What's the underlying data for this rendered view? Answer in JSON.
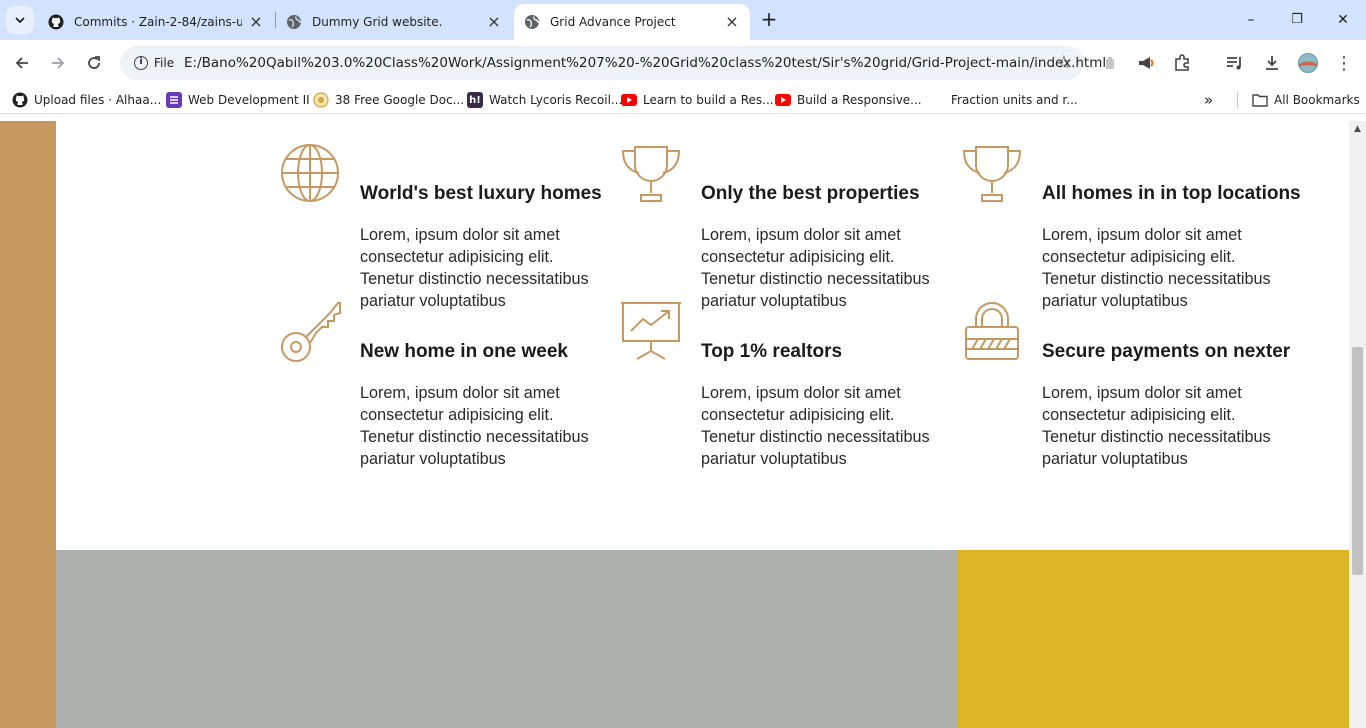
{
  "browser": {
    "tabs": [
      {
        "title": "Commits · Zain-2-84/zains-used",
        "icon": "github-icon",
        "active": false
      },
      {
        "title": "Dummy Grid website.",
        "icon": "globe-icon",
        "active": false
      },
      {
        "title": "Grid Advance Project",
        "icon": "globe-icon",
        "active": true
      }
    ],
    "window_controls": {
      "minimize": "–",
      "restore": "❐",
      "close": "✕"
    },
    "omnibox": {
      "site_label": "File",
      "url": "E:/Bano%20Qabil%203.0%20Class%20Work/Assignment%207%20-%20Grid%20class%20test/Sir's%20grid/Grid-Project-main/index.html"
    },
    "bookmarks": [
      {
        "label": "Upload files · Alhaa...",
        "icon": "github-icon"
      },
      {
        "label": "Web Development II",
        "icon": "list-icon"
      },
      {
        "label": "38 Free Google Doc...",
        "icon": "circle-icon"
      },
      {
        "label": "Watch Lycoris Recoil...",
        "icon": "h-icon"
      },
      {
        "label": "Learn to build a Res...",
        "icon": "youtube-icon"
      },
      {
        "label": "Build a Responsive...",
        "icon": "youtube-icon"
      },
      {
        "label": "Fraction units and r...",
        "icon": "blank-icon"
      }
    ],
    "bookmarks_more": "»",
    "all_bookmarks": "All Bookmarks"
  },
  "page": {
    "accent_color": "#c69963",
    "features": [
      {
        "icon": "globe-icon",
        "title": "World's best luxury homes",
        "text": "Lorem, ipsum dolor sit amet consectetur adipisicing elit. Tenetur distinctio necessitatibus pariatur voluptatibus"
      },
      {
        "icon": "trophy-icon",
        "title": "Only the best properties",
        "text": "Lorem, ipsum dolor sit amet consectetur adipisicing elit. Tenetur distinctio necessitatibus pariatur voluptatibus"
      },
      {
        "icon": "trophy-icon",
        "title": "All homes in in top locations",
        "text": "Lorem, ipsum dolor sit amet consectetur adipisicing elit. Tenetur distinctio necessitatibus pariatur voluptatibus"
      },
      {
        "icon": "key-icon",
        "title": "New home in one week",
        "text": "Lorem, ipsum dolor sit amet consectetur adipisicing elit. Tenetur distinctio necessitatibus pariatur voluptatibus"
      },
      {
        "icon": "presentation-chart-icon",
        "title": "Top 1% realtors",
        "text": "Lorem, ipsum dolor sit amet consectetur adipisicing elit. Tenetur distinctio necessitatibus pariatur voluptatibus"
      },
      {
        "icon": "lock-icon",
        "title": "Secure payments on nexter",
        "text": "Lorem, ipsum dolor sit amet consectetur adipisicing elit. Tenetur distinctio necessitatibus pariatur voluptatibus"
      }
    ],
    "bottom_colors": {
      "gray": "#aeb1ab",
      "gold": "#dcb425"
    }
  }
}
